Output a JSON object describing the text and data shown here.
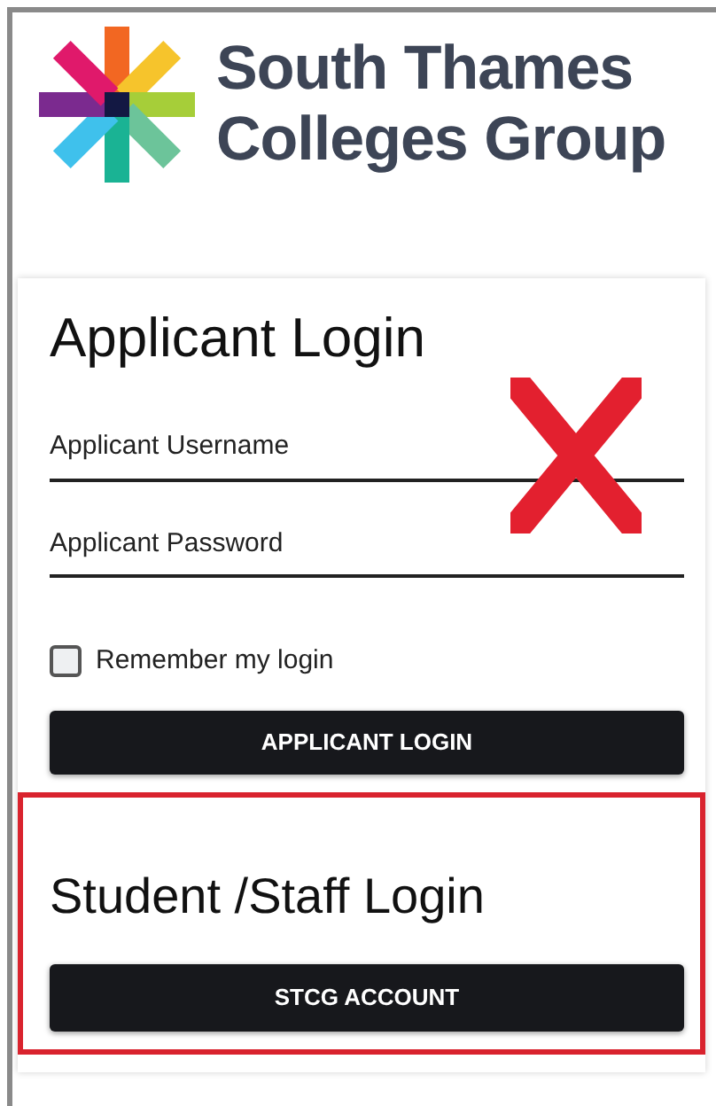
{
  "logo": {
    "lines": [
      "South Thames",
      "Colleges Group"
    ]
  },
  "applicant_login": {
    "title": "Applicant Login",
    "crossed_out": true,
    "fields": [
      {
        "placeholder": "Applicant Username"
      },
      {
        "placeholder": "Applicant Password"
      }
    ],
    "remember": {
      "label": "Remember my login",
      "checked": false
    },
    "button": "APPLICANT LOGIN"
  },
  "staff_login": {
    "title": "Student /Staff Login",
    "highlighted": true,
    "button": "STCG ACCOUNT"
  }
}
